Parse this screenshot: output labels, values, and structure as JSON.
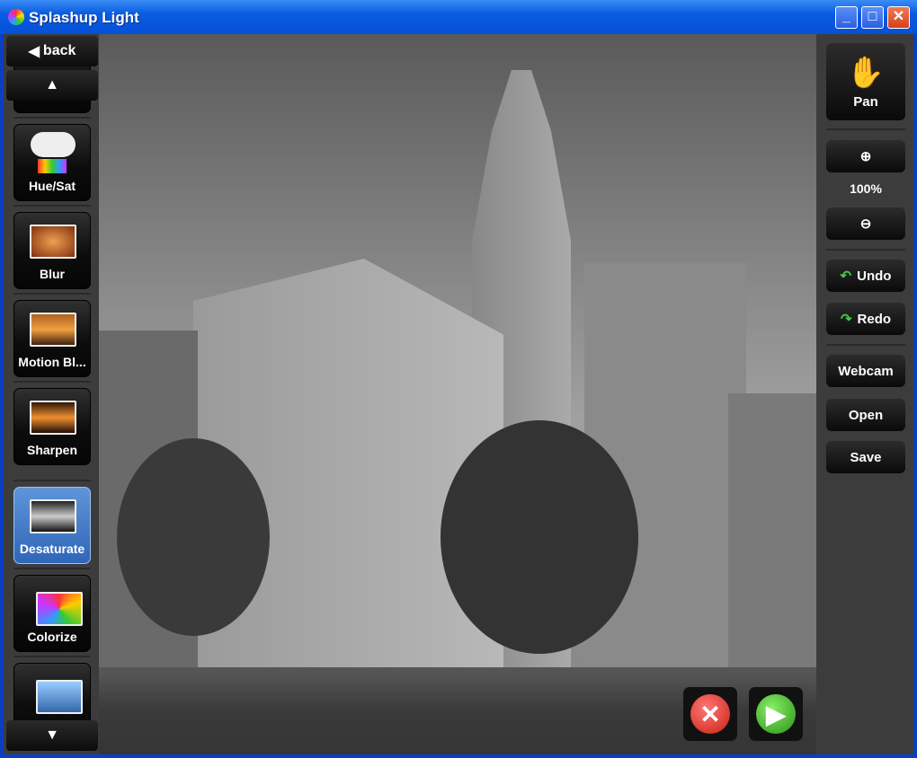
{
  "window": {
    "title": "Splashup Light",
    "minimize": "_",
    "maximize": "□",
    "close": "✕"
  },
  "left": {
    "back": "back",
    "up": "▲",
    "down": "▼",
    "tools": [
      {
        "label": "Hue/Sat"
      },
      {
        "label": "Blur"
      },
      {
        "label": "Motion Bl..."
      },
      {
        "label": "Sharpen"
      },
      {
        "label": "Desaturate",
        "active": true
      },
      {
        "label": "Colorize"
      },
      {
        "label": ""
      }
    ]
  },
  "right": {
    "pan": "Pan",
    "zoom_level": "100%",
    "undo": "Undo",
    "redo": "Redo",
    "webcam": "Webcam",
    "open": "Open",
    "save": "Save"
  },
  "actions": {
    "cancel": "✕",
    "apply": "▶"
  },
  "colors": {
    "accent": "#3f78c8",
    "cancel": "#d83a1c",
    "apply": "#3aa520"
  }
}
